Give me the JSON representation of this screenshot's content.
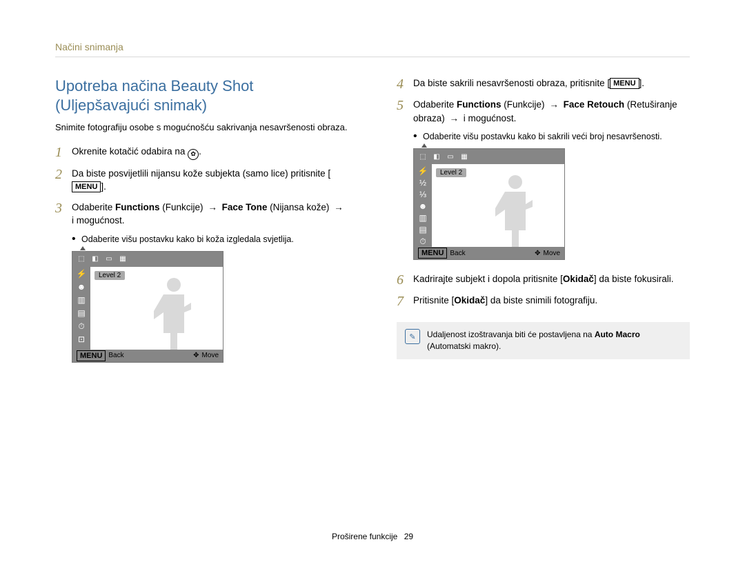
{
  "breadcrumb": "Načini snimanja",
  "title": "Upotreba načina Beauty Shot (Uljepšavajući snimak)",
  "lead": "Snimite fotografiju osobe s mogućnošću sakrivanja nesavršenosti obraza.",
  "menu_btn": "MENU",
  "dial_icon_name": "beauty-mode-dial-icon",
  "left_steps": {
    "s1": {
      "num": "1",
      "pre": "Okrenite kotačić odabira na ",
      "post": "."
    },
    "s2": {
      "num": "2",
      "pre": "Da biste posvijetlili nijansu kože subjekta (samo lice) pritisnite [",
      "post": "]."
    },
    "s3": {
      "num": "3",
      "a": "Odaberite ",
      "b_bold": "Functions",
      "c": " (Funkcije) ",
      "d_bold": "Face Tone",
      "e": " (Nijansa kože) ",
      "f": " i mogućnost."
    },
    "s3_bullet": "Odaberite višu postavku kako bi koža izgledala svjetlija."
  },
  "right_steps": {
    "s4": {
      "num": "4",
      "pre": "Da biste sakrili nesavršenosti obraza, pritisnite [",
      "post": "]."
    },
    "s5": {
      "num": "5",
      "a": "Odaberite ",
      "b_bold": "Functions",
      "c": " (Funkcije) ",
      "d_bold": "Face Retouch",
      "e": " (Retuširanje obraza) ",
      "f": " i mogućnost."
    },
    "s5_bullet": "Odaberite višu postavku kako bi sakrili veći broj nesavršenosti.",
    "s6": {
      "num": "6",
      "a": "Kadrirajte subjekt i dopola pritisnite [",
      "b_bold": "Okidač",
      "c": "] da biste fokusirali."
    },
    "s7": {
      "num": "7",
      "a": "Pritisnite [",
      "b_bold": "Okidač",
      "c": "] da biste snimili fotografiju."
    }
  },
  "lcd": {
    "level": "Level 2",
    "back_btn": "MENU",
    "back_label": "Back",
    "move_label": "Move"
  },
  "note": {
    "a": "Udaljenost izoštravanja biti će postavljena na ",
    "b_bold": "Auto Macro",
    "c": " (Automatski makro)."
  },
  "footer": {
    "section": "Proširene funkcije",
    "page": "29"
  }
}
